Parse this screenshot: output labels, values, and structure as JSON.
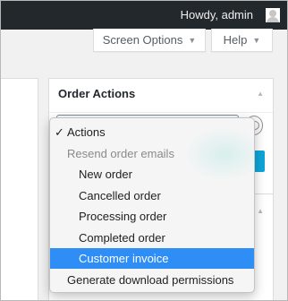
{
  "adminbar": {
    "greeting": "Howdy, admin",
    "avatar_icon": "user-avatar-icon"
  },
  "screen_meta": {
    "screen_options_label": "Screen Options",
    "help_label": "Help",
    "arrow_icon": "triangle-down-icon"
  },
  "order_actions": {
    "title": "Order Actions",
    "toggle_icon": "triangle-up-icon"
  },
  "dropdown": {
    "check_mark": "✓",
    "items": [
      {
        "label": "Actions",
        "type": "option",
        "checked": true
      },
      {
        "label": "Resend order emails",
        "type": "group"
      },
      {
        "label": "New order",
        "type": "option"
      },
      {
        "label": "Cancelled order",
        "type": "option"
      },
      {
        "label": "Processing order",
        "type": "option"
      },
      {
        "label": "Completed order",
        "type": "option"
      },
      {
        "label": "Customer invoice",
        "type": "option",
        "highlighted": true
      },
      {
        "label": "Generate download permissions",
        "type": "option"
      }
    ],
    "highlight_color": "#2f8ef6"
  },
  "colors": {
    "adminbar_bg": "#23282d",
    "primary_button": "#0ea5d8"
  }
}
